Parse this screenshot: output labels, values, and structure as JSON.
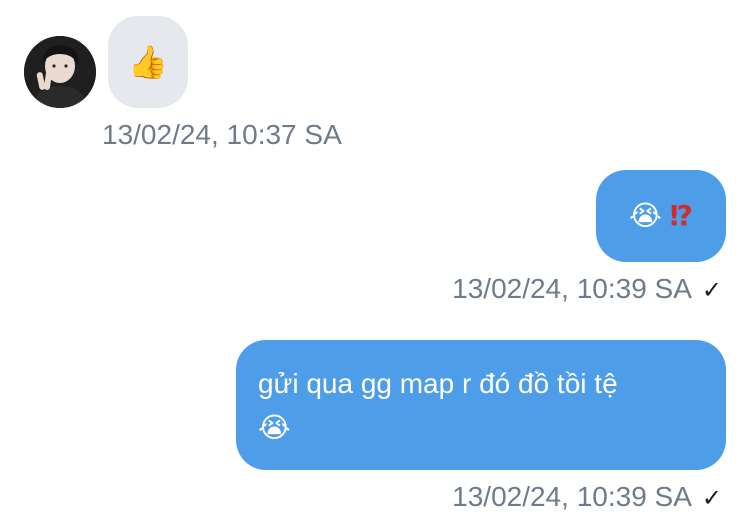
{
  "conversation": {
    "incoming": {
      "emoji": "👍",
      "emoji_icon": "thumbs-up-icon",
      "timestamp": "13/02/24, 10:37 SA"
    },
    "outgoing": [
      {
        "emoji_1": "😭",
        "emoji_2": "⁉",
        "timestamp": "13/02/24, 10:39 SA",
        "status_mark": "✓"
      },
      {
        "text": "gửi qua gg map r đó đồ tồi tệ",
        "emoji": "😭",
        "timestamp": "13/02/24, 10:39 SA",
        "status_mark": "✓"
      }
    ]
  },
  "colors": {
    "outgoing_bubble": "#4d9de8",
    "incoming_bubble": "#e5e8ed",
    "timestamp_text": "#6f7b8a"
  }
}
